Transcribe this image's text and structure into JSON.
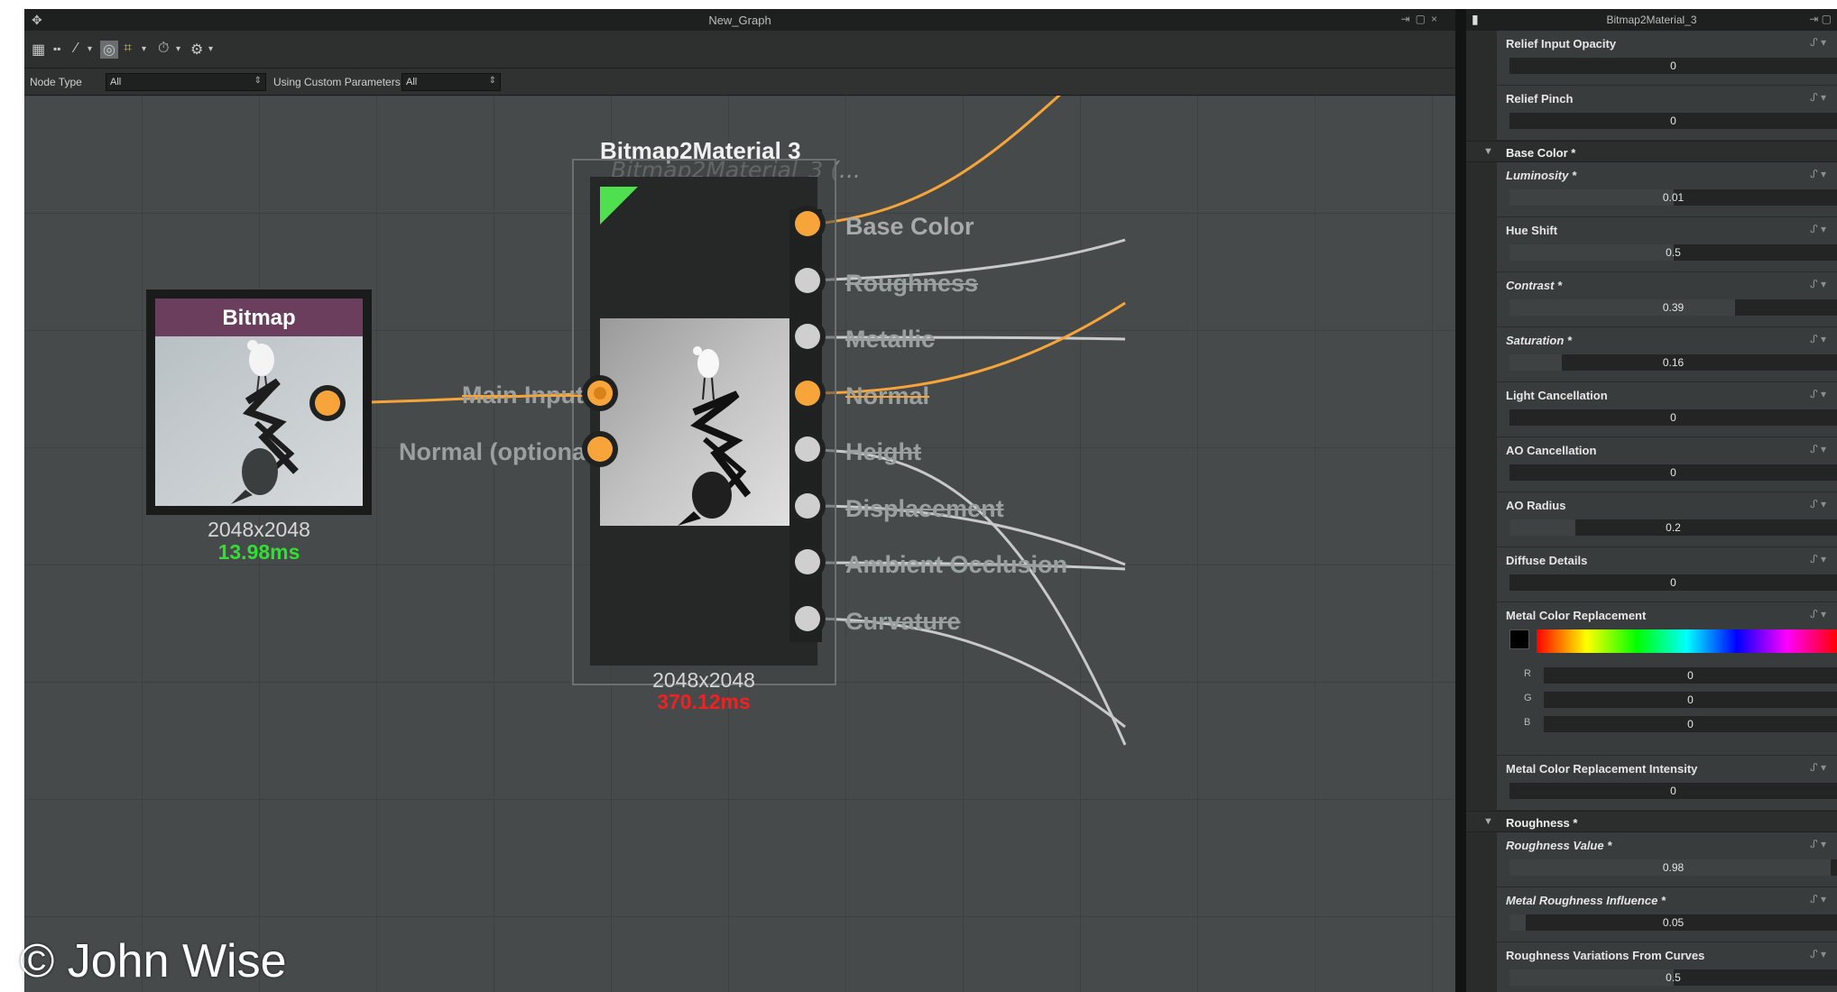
{
  "graph_window": {
    "title": "New_Graph",
    "filter_bar": {
      "node_type_label": "Node Type",
      "node_type_value": "All",
      "custom_params_label": "Using Custom Parameters",
      "custom_params_value": "All"
    }
  },
  "nodes": {
    "bitmap": {
      "header": "Bitmap",
      "resolution": "2048x2048",
      "time": "13.98ms"
    },
    "b2m": {
      "title": "Bitmap2Material 3",
      "subtitle": "Bitmap2Material_3 (...",
      "resolution": "2048x2048",
      "time": "370.12ms",
      "inputs": [
        "Main Input",
        "Normal (optional)"
      ],
      "outputs": [
        "Base Color",
        "Roughness",
        "Metallic",
        "Normal",
        "Height",
        "Displacement",
        "Ambient Occlusion",
        "Curvature"
      ]
    }
  },
  "watermark": "© John Wise",
  "properties": {
    "window_title": "Bitmap2Material_3",
    "rows": {
      "relief_input_opacity": {
        "label": "Relief Input Opacity",
        "value": "0",
        "fill": 0
      },
      "relief_pinch": {
        "label": "Relief Pinch",
        "value": "0",
        "fill": 0
      }
    },
    "base_color": {
      "section": "Base Color *",
      "luminosity": {
        "label": "Luminosity *",
        "value": "0.01",
        "fill": 0.5
      },
      "hue_shift": {
        "label": "Hue Shift",
        "value": "0.5",
        "fill": 0.5
      },
      "contrast": {
        "label": "Contrast *",
        "value": "0.39",
        "fill": 0.69
      },
      "saturation": {
        "label": "Saturation *",
        "value": "0.16",
        "fill": 0.16
      },
      "light_cancellation": {
        "label": "Light Cancellation",
        "value": "0",
        "fill": 0
      },
      "ao_cancellation": {
        "label": "AO Cancellation",
        "value": "0",
        "fill": 0
      },
      "ao_radius": {
        "label": "AO Radius",
        "value": "0.2",
        "fill": 0.2
      },
      "diffuse_details": {
        "label": "Diffuse Details",
        "value": "0",
        "fill": 0
      },
      "metal_color_replacement": {
        "label": "Metal Color Replacement",
        "r": "0",
        "g": "0",
        "b": "0",
        "r_label": "R",
        "g_label": "G",
        "b_label": "B"
      },
      "metal_color_intensity": {
        "label": "Metal Color Replacement Intensity",
        "value": "0",
        "fill": 0
      }
    },
    "roughness": {
      "section": "Roughness *",
      "roughness_value": {
        "label": "Roughness Value *",
        "value": "0.98",
        "fill": 0.98
      },
      "metal_roughness_influence": {
        "label": "Metal Roughness Influence *",
        "value": "0.05",
        "fill": 0.05
      },
      "variations_from_curves": {
        "label": "Roughness Variations From Curves",
        "value": "0.5",
        "fill": 0.5
      }
    }
  },
  "colors": {
    "accent_orange": "#f7a53a",
    "wire_gray": "#c9c9c9",
    "bitmap_header": "#6a3e5c",
    "time_ok": "#33dd33",
    "time_slow": "#ee2222"
  }
}
